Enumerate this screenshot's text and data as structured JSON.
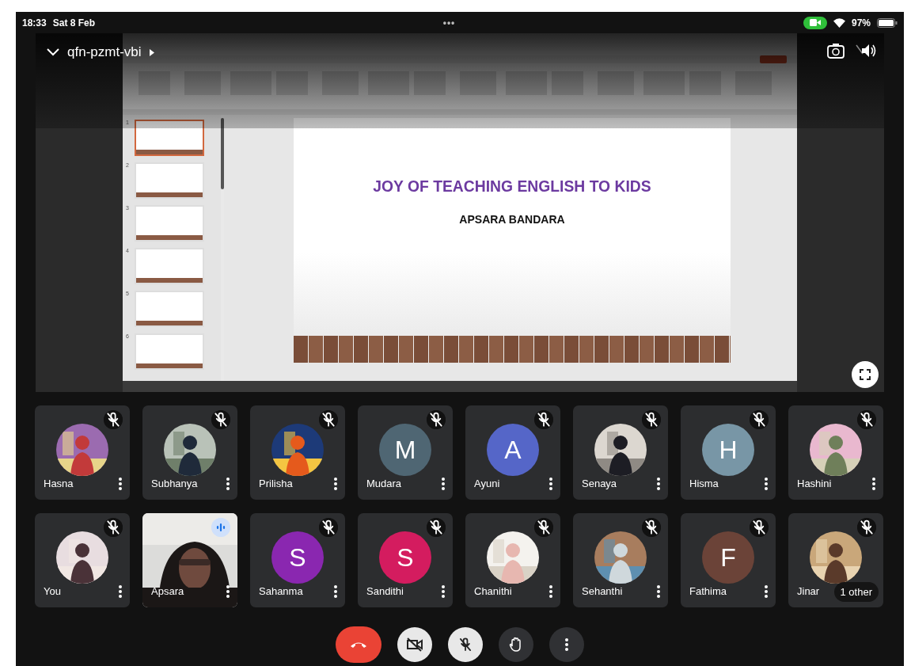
{
  "status_bar": {
    "time": "18:33",
    "date": "Sat 8 Feb",
    "dots": "•••",
    "battery": "97%"
  },
  "meeting": {
    "code": "qfn-pzmt-vbi"
  },
  "presentation": {
    "slides": [
      {
        "number": "1",
        "selected": true
      },
      {
        "number": "2",
        "selected": false
      },
      {
        "number": "3",
        "selected": false
      },
      {
        "number": "4",
        "selected": false
      },
      {
        "number": "5",
        "selected": false
      },
      {
        "number": "6",
        "selected": false
      }
    ],
    "current_slide": {
      "title": "JOY OF TEACHING ENGLISH TO KIDS",
      "subtitle": "APSARA BANDARA"
    }
  },
  "participants": [
    {
      "name": "Hasna",
      "muted": true
    },
    {
      "name": "Subhanya",
      "muted": true
    },
    {
      "name": "Prilisha",
      "muted": true
    },
    {
      "name": "Mudara",
      "kind": "letter",
      "letter": "M",
      "color": "#4f6673",
      "muted": true
    },
    {
      "name": "Ayuni",
      "kind": "letter",
      "letter": "A",
      "color": "#5566c8",
      "muted": true
    },
    {
      "name": "Senaya",
      "muted": true
    },
    {
      "name": "Hisma",
      "kind": "letter",
      "letter": "H",
      "color": "#7896a6",
      "muted": true
    },
    {
      "name": "Hashini",
      "muted": true
    },
    {
      "name": "You",
      "muted": true
    },
    {
      "name": "Apsara",
      "kind": "video",
      "muted": false,
      "speaking": true
    },
    {
      "name": "Sahanma",
      "kind": "letter",
      "letter": "S",
      "color": "#8a27b0",
      "muted": true
    },
    {
      "name": "Sandithi",
      "kind": "letter",
      "letter": "S",
      "color": "#d41c5f",
      "muted": true
    },
    {
      "name": "Chanithi",
      "muted": true
    },
    {
      "name": "Sehanthi",
      "muted": true
    },
    {
      "name": "Fathima",
      "kind": "letter",
      "letter": "F",
      "color": "#6b4338",
      "muted": true
    },
    {
      "name": "Jinar",
      "muted": true,
      "others": "1 other"
    }
  ],
  "controls": [
    {
      "kind": "end_call"
    },
    {
      "kind": "camera",
      "on": false
    },
    {
      "kind": "mic",
      "on": false
    },
    {
      "kind": "hand"
    },
    {
      "kind": "more"
    }
  ]
}
